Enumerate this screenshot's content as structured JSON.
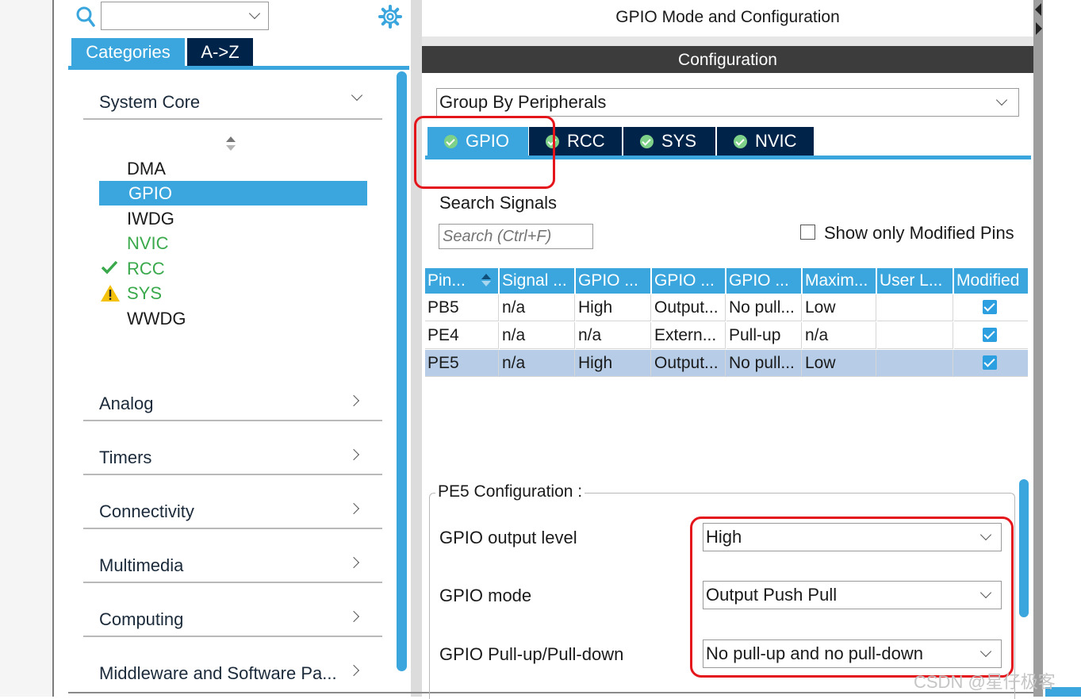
{
  "left_panel": {
    "search_value": "",
    "tabs": [
      "Categories",
      "A->Z"
    ],
    "categories": {
      "system_core": "System Core",
      "items": [
        {
          "label": "DMA",
          "status": "none",
          "color": "#1a1a1a"
        },
        {
          "label": "GPIO",
          "status": "selected",
          "color": "#ffffff"
        },
        {
          "label": "IWDG",
          "status": "none",
          "color": "#1a1a1a"
        },
        {
          "label": "NVIC",
          "status": "none",
          "color": "#3aa94c"
        },
        {
          "label": "RCC",
          "status": "ok",
          "color": "#3aa94c"
        },
        {
          "label": "SYS",
          "status": "warning",
          "color": "#3aa94c"
        },
        {
          "label": "WWDG",
          "status": "none",
          "color": "#1a1a1a"
        }
      ],
      "others": [
        "Analog",
        "Timers",
        "Connectivity",
        "Multimedia",
        "Computing",
        "Middleware and Software Pa..."
      ]
    }
  },
  "right_panel": {
    "header_title": "GPIO Mode and Configuration",
    "config_bar": "Configuration",
    "group_by": "Group By Peripherals",
    "tabs": [
      "GPIO",
      "RCC",
      "SYS",
      "NVIC"
    ],
    "search_label": "Search Signals",
    "search_placeholder": "Search (Ctrl+F)",
    "show_modified_label": "Show only Modified Pins",
    "table": {
      "headers": [
        "Pin...",
        "Signal ...",
        "GPIO ...",
        "GPIO ...",
        "GPIO ...",
        "Maxim...",
        "User L...",
        "Modified"
      ],
      "rows": [
        [
          "PB5",
          "n/a",
          "High",
          "Output...",
          "No pull...",
          "Low",
          "",
          "checked"
        ],
        [
          "PE4",
          "n/a",
          "n/a",
          "Extern...",
          "Pull-up",
          "n/a",
          "",
          "checked"
        ],
        [
          "PE5",
          "n/a",
          "High",
          "Output...",
          "No pull...",
          "Low",
          "",
          "checked"
        ]
      ],
      "selected_row": 2
    },
    "pin_config": {
      "title": "PE5 Configuration :",
      "fields": [
        {
          "label": "GPIO output level",
          "value": "High"
        },
        {
          "label": "GPIO mode",
          "value": "Output Push Pull"
        },
        {
          "label": "GPIO Pull-up/Pull-down",
          "value": "No pull-up and no pull-down"
        }
      ]
    }
  },
  "watermark": "CSDN @星仔极客",
  "colors": {
    "accent_blue": "#3aa6dd",
    "tab_navy": "#002449",
    "config_bar": "#3c3c3c",
    "highlight_red": "#e5161b",
    "ok_green": "#3aa94c",
    "warn_yellow": "#f4c20d"
  }
}
